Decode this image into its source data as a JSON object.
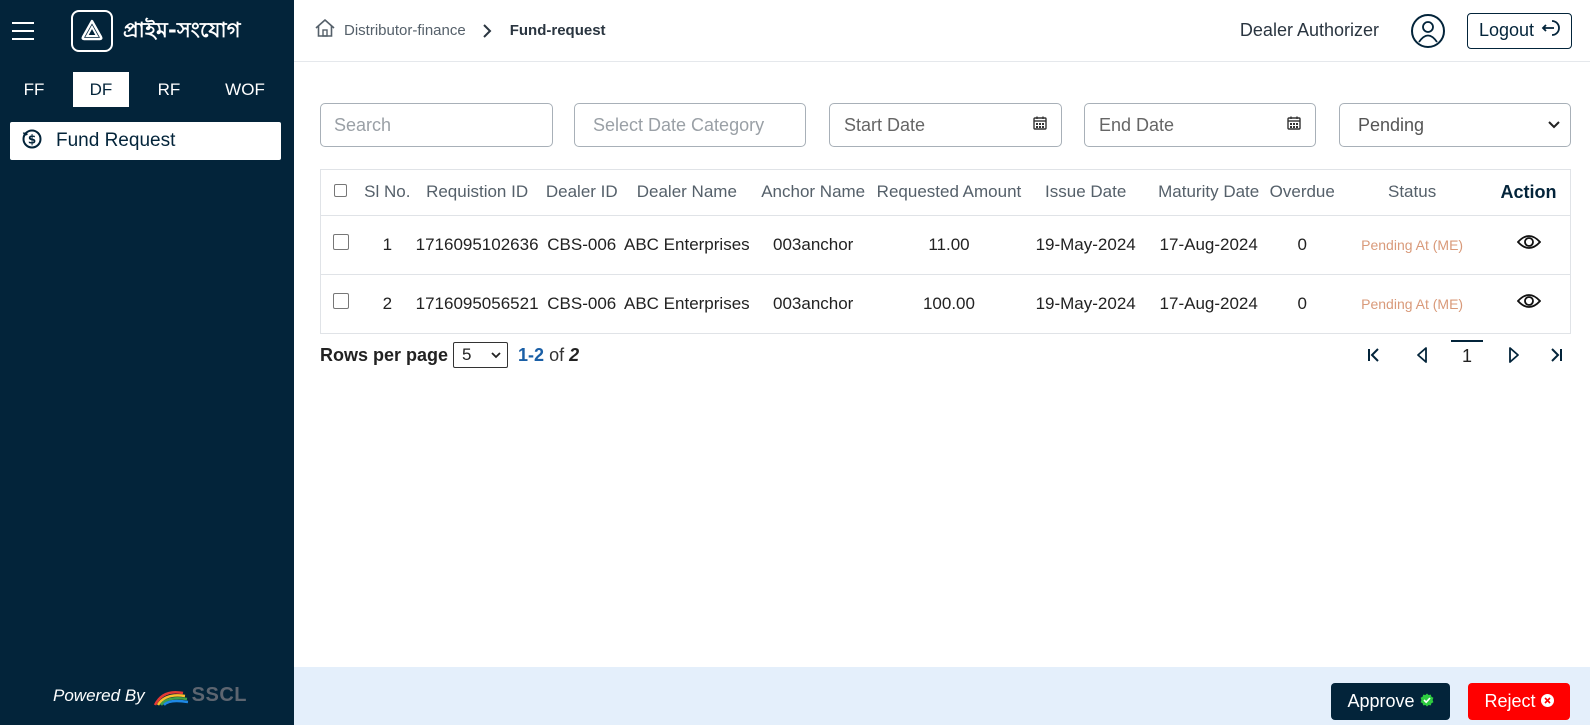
{
  "brand": {
    "name": "প্রাইম-সংযোগ"
  },
  "sidebar": {
    "product_tabs": [
      {
        "label": "FF",
        "active": false
      },
      {
        "label": "DF",
        "active": true
      },
      {
        "label": "RF",
        "active": false
      },
      {
        "label": "WOF",
        "active": false
      }
    ],
    "menu": [
      {
        "label": "Fund Request",
        "icon": "dollar-circle-icon"
      }
    ],
    "powered_by": "Powered By",
    "powered_brand": "SSCL"
  },
  "header": {
    "breadcrumb": [
      "Distributor-finance",
      "Fund-request"
    ],
    "user_role": "Dealer Authorizer",
    "logout_label": "Logout"
  },
  "filters": {
    "search_placeholder": "Search",
    "date_category_placeholder": "Select Date Category",
    "start_date": "Start Date",
    "end_date": "End Date",
    "status": "Pending"
  },
  "table": {
    "columns": [
      "Sl No.",
      "Requistion ID",
      "Dealer ID",
      "Dealer Name",
      "Anchor Name",
      "Requested Amount",
      "Issue Date",
      "Maturity Date",
      "Overdue",
      "Status",
      "Action"
    ],
    "rows": [
      {
        "sl": "1",
        "req_id": "1716095102636",
        "dealer_id": "CBS-006",
        "dealer_name": "ABC Enterprises",
        "anchor": "003anchor",
        "amount": "11.00",
        "issue": "19-May-2024",
        "maturity": "17-Aug-2024",
        "overdue": "0",
        "status": "Pending At (ME)"
      },
      {
        "sl": "2",
        "req_id": "1716095056521",
        "dealer_id": "CBS-006",
        "dealer_name": "ABC Enterprises",
        "anchor": "003anchor",
        "amount": "100.00",
        "issue": "19-May-2024",
        "maturity": "17-Aug-2024",
        "overdue": "0",
        "status": "Pending At (ME)"
      }
    ]
  },
  "pagination": {
    "rows_label": "Rows per page",
    "rows_value": "5",
    "range_from": "1",
    "range_to": "2",
    "of": "of",
    "total": "2",
    "current_page": "1"
  },
  "actions": {
    "approve": "Approve",
    "reject": "Reject"
  },
  "colors": {
    "sidebar_bg": "#03243a",
    "accent": "#03243a",
    "status_pending": "#d99a7a",
    "reject": "#ff0000",
    "footer_bg": "#e4effb",
    "approve_check": "#2ecc40"
  }
}
